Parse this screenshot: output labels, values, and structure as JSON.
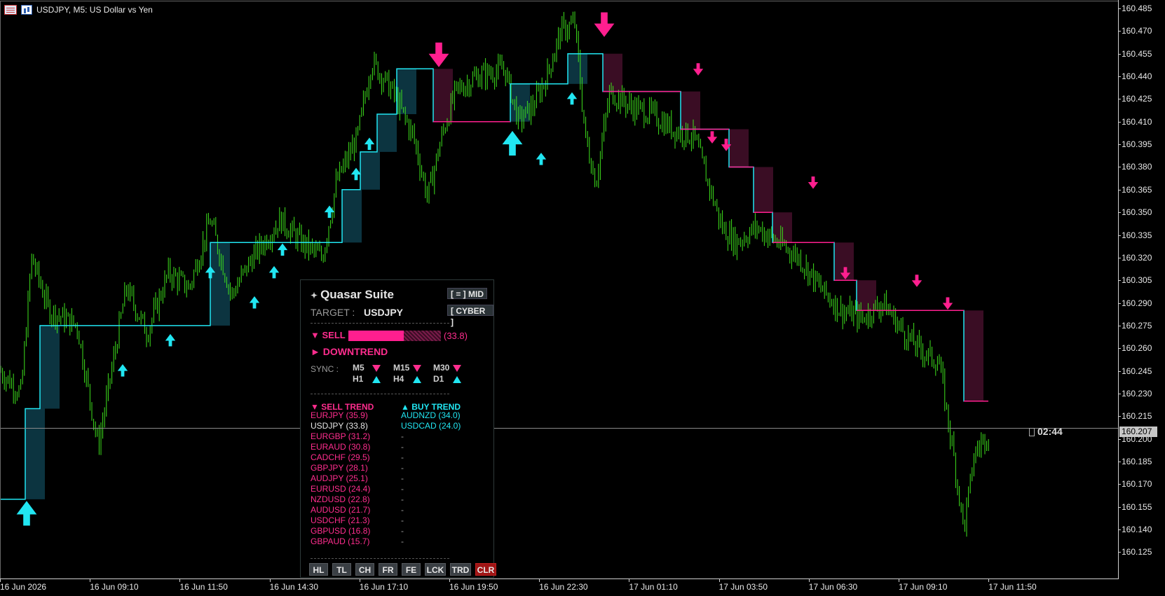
{
  "header": {
    "symbol_line": "USDJPY, M5:  US Dollar vs Yen",
    "icon_left": "table-icon",
    "icon_right": "chart-icon"
  },
  "y_axis": {
    "ticks": [
      "160.485",
      "160.470",
      "160.455",
      "160.440",
      "160.425",
      "160.410",
      "160.395",
      "160.380",
      "160.365",
      "160.350",
      "160.335",
      "160.320",
      "160.305",
      "160.290",
      "160.275",
      "160.260",
      "160.245",
      "160.230",
      "160.215",
      "160.200",
      "160.185",
      "160.170",
      "160.155",
      "160.140",
      "160.125"
    ],
    "current_price": "160.207"
  },
  "x_axis": {
    "ticks": [
      "16 Jun 2026",
      "16 Jun 09:10",
      "16 Jun 11:50",
      "16 Jun 14:30",
      "16 Jun 17:10",
      "16 Jun 19:50",
      "16 Jun 22:30",
      "17 Jun 01:10",
      "17 Jun 03:50",
      "17 Jun 06:30",
      "17 Jun 09:10",
      "17 Jun 11:50"
    ]
  },
  "candle_timer": "02:44",
  "colors": {
    "candle": "#3ee21c",
    "buy": "#21e6f2",
    "sell": "#ff1f8f",
    "buy_fill": "#0c3440",
    "sell_fill": "#3a0d24",
    "price_line": "#8a8a8a"
  },
  "panel": {
    "title": "Quasar Suite",
    "mid_button": "[ = ] MID",
    "theme_button": "[ CYBER ]",
    "target_label": "TARGET :",
    "target_value": "USDJPY",
    "signal_label": "▼ SELL",
    "signal_strength": 0.6,
    "signal_score": "(33.8)",
    "trend_label": "► DOWNTREND",
    "sync_label": "SYNC :",
    "sync": [
      {
        "tf": "M5",
        "dir": "down"
      },
      {
        "tf": "M15",
        "dir": "down"
      },
      {
        "tf": "M30",
        "dir": "down"
      },
      {
        "tf": "H1",
        "dir": "up"
      },
      {
        "tf": "H4",
        "dir": "up"
      },
      {
        "tf": "D1",
        "dir": "up"
      }
    ],
    "sell_trend_header": "▼ SELL TREND",
    "buy_trend_header": "▲ BUY TREND",
    "sell_trend": [
      "EURJPY (35.9)",
      "USDJPY (33.8)",
      "EURGBP (31.2)",
      "EURAUD (30.8)",
      "CADCHF (29.5)",
      "GBPJPY (28.1)",
      "AUDJPY (25.1)",
      "EURUSD (24.4)",
      "NZDUSD (22.8)",
      "AUDUSD (21.7)",
      "USDCHF (21.3)",
      "GBPUSD (16.8)",
      "GBPAUD (15.7)"
    ],
    "buy_trend": [
      "AUDNZD (34.0)",
      "USDCAD (24.0)",
      "-",
      "-",
      "-",
      "-",
      "-",
      "-",
      "-",
      "-",
      "-",
      "-",
      "-"
    ],
    "tool_buttons": [
      "HL",
      "TL",
      "CH",
      "FR",
      "FE",
      "LCK",
      "TRD",
      "CLR"
    ]
  }
}
